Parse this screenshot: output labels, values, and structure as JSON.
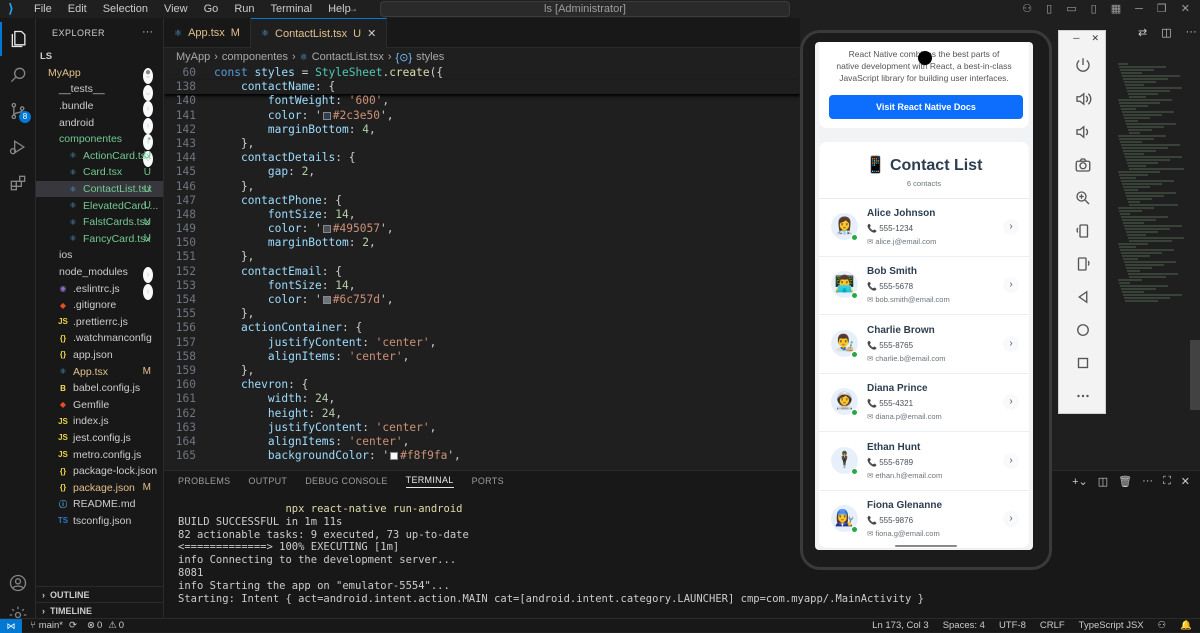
{
  "titlebar": {
    "menu": [
      "File",
      "Edit",
      "Selection",
      "View",
      "Go",
      "Run",
      "Terminal",
      "Help"
    ],
    "search_text": "ls [Administrator]"
  },
  "explorer": {
    "header": "EXPLORER",
    "root": "LS",
    "project": "MyApp",
    "items": [
      {
        "label": "__tests__",
        "kind": "folder",
        "status": ""
      },
      {
        "label": ".bundle",
        "kind": "folder",
        "status": ""
      },
      {
        "label": "android",
        "kind": "folder",
        "status": ""
      },
      {
        "label": "componentes",
        "kind": "folder-open",
        "status": "•"
      },
      {
        "label": "ActionCard.tsx",
        "kind": "tsx",
        "status": "U"
      },
      {
        "label": "Card.tsx",
        "kind": "tsx",
        "status": "U"
      },
      {
        "label": "ContactList.tsx",
        "kind": "tsx",
        "status": "U"
      },
      {
        "label": "ElevatedCard....",
        "kind": "tsx",
        "status": "U"
      },
      {
        "label": "FalstCards.tsx",
        "kind": "tsx",
        "status": "U"
      },
      {
        "label": "FancyCard.tsx",
        "kind": "tsx",
        "status": "U"
      },
      {
        "label": "ios",
        "kind": "folder",
        "status": ""
      },
      {
        "label": "node_modules",
        "kind": "folder",
        "status": ""
      },
      {
        "label": ".eslintrc.js",
        "kind": "eslint",
        "status": ""
      },
      {
        "label": ".gitignore",
        "kind": "git",
        "status": ""
      },
      {
        "label": ".prettierrc.js",
        "kind": "js",
        "status": ""
      },
      {
        "label": ".watchmanconfig",
        "kind": "json",
        "status": ""
      },
      {
        "label": "app.json",
        "kind": "json",
        "status": ""
      },
      {
        "label": "App.tsx",
        "kind": "tsx",
        "status": "M"
      },
      {
        "label": "babel.config.js",
        "kind": "babel",
        "status": ""
      },
      {
        "label": "Gemfile",
        "kind": "gem",
        "status": ""
      },
      {
        "label": "index.js",
        "kind": "js",
        "status": ""
      },
      {
        "label": "jest.config.js",
        "kind": "js",
        "status": ""
      },
      {
        "label": "metro.config.js",
        "kind": "js",
        "status": ""
      },
      {
        "label": "package-lock.json",
        "kind": "json",
        "status": ""
      },
      {
        "label": "package.json",
        "kind": "json",
        "status": "M"
      },
      {
        "label": "README.md",
        "kind": "md",
        "status": ""
      },
      {
        "label": "tsconfig.json",
        "kind": "tsconfig",
        "status": ""
      }
    ],
    "outline": "OUTLINE",
    "timeline": "TIMELINE"
  },
  "tabs": [
    {
      "label": "App.tsx",
      "status": "M",
      "active": false
    },
    {
      "label": "ContactList.tsx",
      "status": "U",
      "active": true
    }
  ],
  "breadcrumb": [
    "MyApp",
    "componentes",
    "ContactList.tsx",
    "styles"
  ],
  "code": [
    {
      "n": "60",
      "t": "const styles = StyleSheet.create({"
    },
    {
      "n": "138",
      "t": "    contactName: {"
    },
    {
      "n": "140",
      "t": "        fontWeight: '600',"
    },
    {
      "n": "141",
      "t": "        color: '#2c3e50',"
    },
    {
      "n": "142",
      "t": "        marginBottom: 4,"
    },
    {
      "n": "143",
      "t": "    },"
    },
    {
      "n": "144",
      "t": "    contactDetails: {"
    },
    {
      "n": "145",
      "t": "        gap: 2,"
    },
    {
      "n": "146",
      "t": "    },"
    },
    {
      "n": "147",
      "t": "    contactPhone: {"
    },
    {
      "n": "148",
      "t": "        fontSize: 14,"
    },
    {
      "n": "149",
      "t": "        color: '#495057',"
    },
    {
      "n": "150",
      "t": "        marginBottom: 2,"
    },
    {
      "n": "151",
      "t": "    },"
    },
    {
      "n": "152",
      "t": "    contactEmail: {"
    },
    {
      "n": "153",
      "t": "        fontSize: 14,"
    },
    {
      "n": "154",
      "t": "        color: '#6c757d',"
    },
    {
      "n": "155",
      "t": "    },"
    },
    {
      "n": "156",
      "t": "    actionContainer: {"
    },
    {
      "n": "157",
      "t": "        justifyContent: 'center',"
    },
    {
      "n": "158",
      "t": "        alignItems: 'center',"
    },
    {
      "n": "159",
      "t": "    },"
    },
    {
      "n": "160",
      "t": "    chevron: {"
    },
    {
      "n": "161",
      "t": "        width: 24,"
    },
    {
      "n": "162",
      "t": "        height: 24,"
    },
    {
      "n": "163",
      "t": "        justifyContent: 'center',"
    },
    {
      "n": "164",
      "t": "        alignItems: 'center',"
    },
    {
      "n": "165",
      "t": "        backgroundColor: '#f8f9fa',"
    }
  ],
  "panel": {
    "tabs": [
      "PROBLEMS",
      "OUTPUT",
      "DEBUG CONSOLE",
      "TERMINAL",
      "PORTS"
    ],
    "active_tab": "TERMINAL",
    "terminal": [
      "                 npx react-native run-android",
      "BUILD SUCCESSFUL in 1m 11s",
      "82 actionable tasks: 9 executed, 73 up-to-date",
      "<=============> 100% EXECUTING [1m]",
      "info Connecting to the development server...",
      "8081",
      "info Starting the app on \"emulator-5554\"...",
      "Starting: Intent { act=android.intent.action.MAIN cat=[android.intent.category.LAUNCHER] cmp=com.myapp/.MainActivity }"
    ]
  },
  "statusbar": {
    "branch": "main*",
    "errors": "0",
    "warnings": "0",
    "position": "Ln 173, Col 3",
    "spaces": "Spaces: 4",
    "encoding": "UTF-8",
    "eol": "CRLF",
    "language": "TypeScript JSX"
  },
  "phone": {
    "intro_lines": [
      "React Native combines the best parts of",
      "native development with React, a best-in-class",
      "JavaScript library for building user interfaces."
    ],
    "docs_button": "Visit React Native Docs",
    "list_title": "📱 Contact List",
    "list_count": "6 contacts",
    "contacts": [
      {
        "name": "Alice Johnson",
        "phone": "555-1234",
        "email": "alice.j@email.com",
        "emoji": "👩‍⚕️"
      },
      {
        "name": "Bob Smith",
        "phone": "555-5678",
        "email": "bob.smith@email.com",
        "emoji": "👨‍💻"
      },
      {
        "name": "Charlie Brown",
        "phone": "555-8765",
        "email": "charlie.b@email.com",
        "emoji": "👨‍🎨"
      },
      {
        "name": "Diana Prince",
        "phone": "555-4321",
        "email": "diana.p@email.com",
        "emoji": "👩‍🚀"
      },
      {
        "name": "Ethan Hunt",
        "phone": "555-6789",
        "email": "ethan.h@email.com",
        "emoji": "🕴"
      },
      {
        "name": "Fiona Glenanne",
        "phone": "555-9876",
        "email": "fiona.g@email.com",
        "emoji": "👩‍🔧"
      }
    ]
  },
  "emulator_toolbar": {
    "buttons": [
      "power-icon",
      "volume-up-icon",
      "volume-down-icon",
      "camera-icon",
      "zoom-icon",
      "rotate-left-icon",
      "rotate-right-icon",
      "back-icon",
      "home-icon",
      "overview-icon",
      "more-icon"
    ]
  }
}
